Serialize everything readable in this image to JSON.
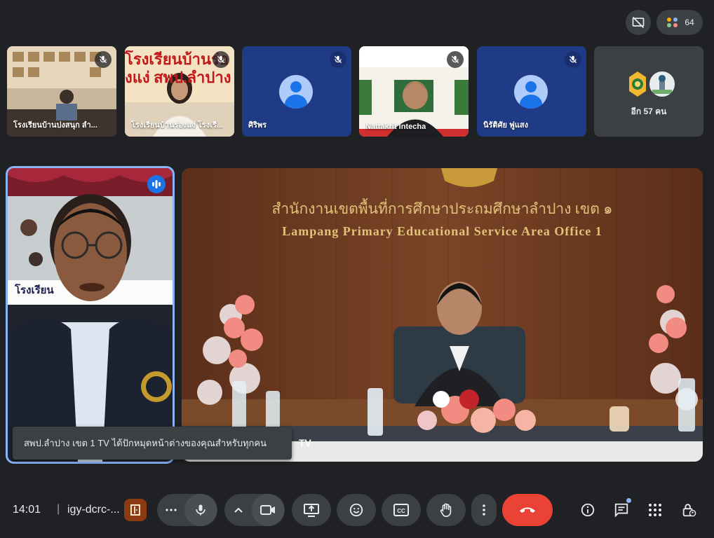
{
  "header": {
    "participant_count": "64"
  },
  "strip": {
    "tiles": [
      {
        "name": "โรงเรียนบ้านปงสนุก ลำ..."
      },
      {
        "name": "โรงเรียนบ้านร่องแง่ โรงเรี..."
      },
      {
        "name": "ศิริพร"
      },
      {
        "name": "Nattakrit Intecha"
      },
      {
        "name": "นิรัติศัย ฟูแสง"
      }
    ],
    "more_label": "อีก 57 คน"
  },
  "main": {
    "banner_th": "สำนักงานเขตพื้นที่การศึกษาประถมศึกษาลำปาง เขต ๑",
    "banner_en": "Lampang Primary Educational Service Area Office 1",
    "bg_sign_text": "โรงเรียนบ้านร่องแง่ สพป.ลำปาง",
    "left_sign_text": "โรงเรียน",
    "presenter_tag": "TV",
    "toast": "สพป.ลำปาง เขต 1 TV ได้ปักหมุดหน้าต่างของคุณสำหรับทุกคน"
  },
  "bottom": {
    "time": "14:01",
    "separator": "|",
    "meeting_code": "igy-dcrc-..."
  },
  "colors": {
    "background": "#202124",
    "control": "#3c4043",
    "end_call": "#ea4335",
    "speaking_border": "#8ab4f8",
    "wood": "#6b3a22"
  }
}
